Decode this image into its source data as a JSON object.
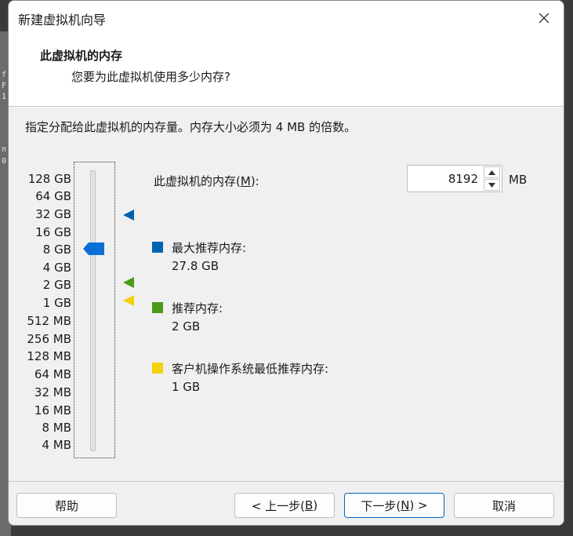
{
  "dialog": {
    "title": "新建虚拟机向导",
    "header_title": "此虚拟机的内存",
    "header_subtitle": "您要为此虚拟机使用多少内存?",
    "instruction": "指定分配给此虚拟机的内存量。内存大小必须为 4 MB 的倍数。"
  },
  "memory": {
    "label_prefix": "此虚拟机的内存(",
    "label_key": "M",
    "label_suffix": "):",
    "value": "8192",
    "unit": "MB"
  },
  "slider": {
    "ticks": [
      "128 GB",
      "64 GB",
      "32 GB",
      "16 GB",
      "8 GB",
      "4 GB",
      "2 GB",
      "1 GB",
      "512 MB",
      "256 MB",
      "128 MB",
      "64 MB",
      "32 MB",
      "16 MB",
      "8 MB",
      "4 MB"
    ],
    "selected": "8 GB"
  },
  "legend": {
    "max": {
      "label": "最大推荐内存:",
      "value": "27.8 GB",
      "color": "#0063b1"
    },
    "recommended": {
      "label": "推荐内存:",
      "value": "2 GB",
      "color": "#4d9a1b"
    },
    "guest_min": {
      "label": "客户机操作系统最低推荐内存:",
      "value": "1 GB",
      "color": "#f2d20e"
    }
  },
  "buttons": {
    "help": "帮助",
    "back_prefix": "< 上一步(",
    "back_key": "B",
    "back_suffix": ")",
    "next_prefix": "下一步(",
    "next_key": "N",
    "next_suffix": ") >",
    "cancel": "取消"
  },
  "background": {
    "fragments": [
      "f",
      "F",
      "1",
      "n",
      "0"
    ]
  },
  "icons": {
    "close": "close-icon",
    "spin_up": "chevron-up-icon",
    "spin_down": "chevron-down-icon"
  }
}
